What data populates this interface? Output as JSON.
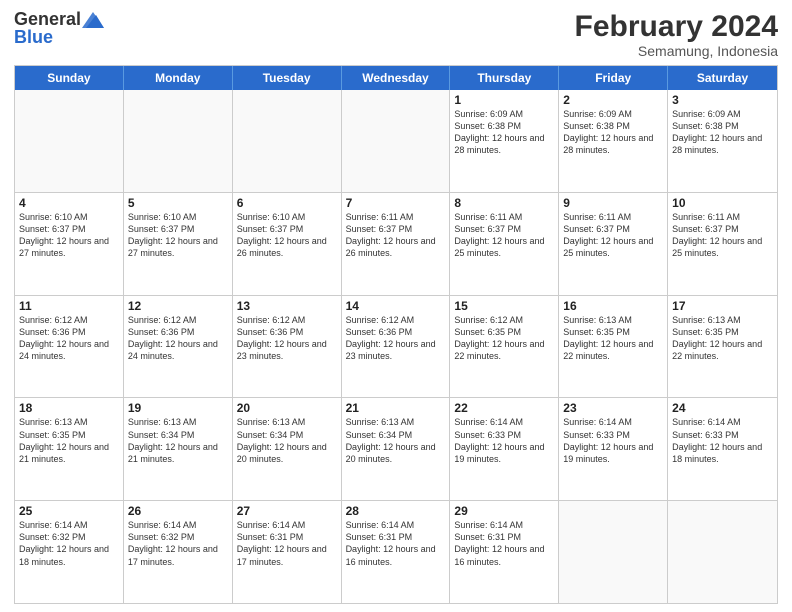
{
  "header": {
    "logo_general": "General",
    "logo_blue": "Blue",
    "month_title": "February 2024",
    "location": "Semamung, Indonesia"
  },
  "days_of_week": [
    "Sunday",
    "Monday",
    "Tuesday",
    "Wednesday",
    "Thursday",
    "Friday",
    "Saturday"
  ],
  "weeks": [
    [
      {
        "day": "",
        "info": ""
      },
      {
        "day": "",
        "info": ""
      },
      {
        "day": "",
        "info": ""
      },
      {
        "day": "",
        "info": ""
      },
      {
        "day": "1",
        "info": "Sunrise: 6:09 AM\nSunset: 6:38 PM\nDaylight: 12 hours and 28 minutes."
      },
      {
        "day": "2",
        "info": "Sunrise: 6:09 AM\nSunset: 6:38 PM\nDaylight: 12 hours and 28 minutes."
      },
      {
        "day": "3",
        "info": "Sunrise: 6:09 AM\nSunset: 6:38 PM\nDaylight: 12 hours and 28 minutes."
      }
    ],
    [
      {
        "day": "4",
        "info": "Sunrise: 6:10 AM\nSunset: 6:37 PM\nDaylight: 12 hours and 27 minutes."
      },
      {
        "day": "5",
        "info": "Sunrise: 6:10 AM\nSunset: 6:37 PM\nDaylight: 12 hours and 27 minutes."
      },
      {
        "day": "6",
        "info": "Sunrise: 6:10 AM\nSunset: 6:37 PM\nDaylight: 12 hours and 26 minutes."
      },
      {
        "day": "7",
        "info": "Sunrise: 6:11 AM\nSunset: 6:37 PM\nDaylight: 12 hours and 26 minutes."
      },
      {
        "day": "8",
        "info": "Sunrise: 6:11 AM\nSunset: 6:37 PM\nDaylight: 12 hours and 25 minutes."
      },
      {
        "day": "9",
        "info": "Sunrise: 6:11 AM\nSunset: 6:37 PM\nDaylight: 12 hours and 25 minutes."
      },
      {
        "day": "10",
        "info": "Sunrise: 6:11 AM\nSunset: 6:37 PM\nDaylight: 12 hours and 25 minutes."
      }
    ],
    [
      {
        "day": "11",
        "info": "Sunrise: 6:12 AM\nSunset: 6:36 PM\nDaylight: 12 hours and 24 minutes."
      },
      {
        "day": "12",
        "info": "Sunrise: 6:12 AM\nSunset: 6:36 PM\nDaylight: 12 hours and 24 minutes."
      },
      {
        "day": "13",
        "info": "Sunrise: 6:12 AM\nSunset: 6:36 PM\nDaylight: 12 hours and 23 minutes."
      },
      {
        "day": "14",
        "info": "Sunrise: 6:12 AM\nSunset: 6:36 PM\nDaylight: 12 hours and 23 minutes."
      },
      {
        "day": "15",
        "info": "Sunrise: 6:12 AM\nSunset: 6:35 PM\nDaylight: 12 hours and 22 minutes."
      },
      {
        "day": "16",
        "info": "Sunrise: 6:13 AM\nSunset: 6:35 PM\nDaylight: 12 hours and 22 minutes."
      },
      {
        "day": "17",
        "info": "Sunrise: 6:13 AM\nSunset: 6:35 PM\nDaylight: 12 hours and 22 minutes."
      }
    ],
    [
      {
        "day": "18",
        "info": "Sunrise: 6:13 AM\nSunset: 6:35 PM\nDaylight: 12 hours and 21 minutes."
      },
      {
        "day": "19",
        "info": "Sunrise: 6:13 AM\nSunset: 6:34 PM\nDaylight: 12 hours and 21 minutes."
      },
      {
        "day": "20",
        "info": "Sunrise: 6:13 AM\nSunset: 6:34 PM\nDaylight: 12 hours and 20 minutes."
      },
      {
        "day": "21",
        "info": "Sunrise: 6:13 AM\nSunset: 6:34 PM\nDaylight: 12 hours and 20 minutes."
      },
      {
        "day": "22",
        "info": "Sunrise: 6:14 AM\nSunset: 6:33 PM\nDaylight: 12 hours and 19 minutes."
      },
      {
        "day": "23",
        "info": "Sunrise: 6:14 AM\nSunset: 6:33 PM\nDaylight: 12 hours and 19 minutes."
      },
      {
        "day": "24",
        "info": "Sunrise: 6:14 AM\nSunset: 6:33 PM\nDaylight: 12 hours and 18 minutes."
      }
    ],
    [
      {
        "day": "25",
        "info": "Sunrise: 6:14 AM\nSunset: 6:32 PM\nDaylight: 12 hours and 18 minutes."
      },
      {
        "day": "26",
        "info": "Sunrise: 6:14 AM\nSunset: 6:32 PM\nDaylight: 12 hours and 17 minutes."
      },
      {
        "day": "27",
        "info": "Sunrise: 6:14 AM\nSunset: 6:31 PM\nDaylight: 12 hours and 17 minutes."
      },
      {
        "day": "28",
        "info": "Sunrise: 6:14 AM\nSunset: 6:31 PM\nDaylight: 12 hours and 16 minutes."
      },
      {
        "day": "29",
        "info": "Sunrise: 6:14 AM\nSunset: 6:31 PM\nDaylight: 12 hours and 16 minutes."
      },
      {
        "day": "",
        "info": ""
      },
      {
        "day": "",
        "info": ""
      }
    ]
  ]
}
